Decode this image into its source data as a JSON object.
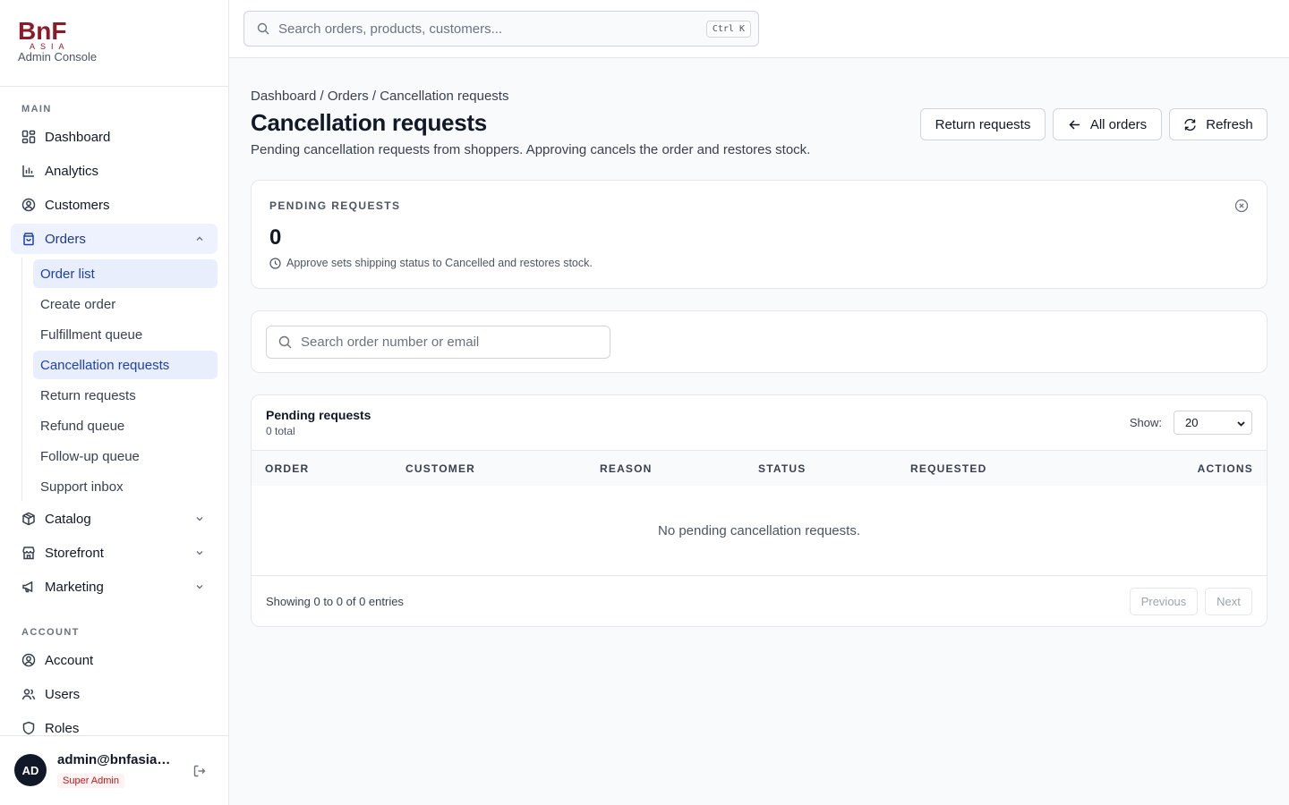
{
  "brand": {
    "logo_text": "BnF",
    "logo_subtext": "ASIA",
    "subtitle": "Admin Console",
    "logo_color": "#8b1a2b"
  },
  "sidebar": {
    "sections": {
      "main": "MAIN",
      "account": "ACCOUNT"
    },
    "items": {
      "dashboard": {
        "label": "Dashboard",
        "icon": "dashboard-grid-icon"
      },
      "analytics": {
        "label": "Analytics",
        "icon": "bar-chart-icon"
      },
      "customers": {
        "label": "Customers",
        "icon": "user-circle-icon"
      },
      "orders": {
        "label": "Orders",
        "icon": "shopping-bag-icon"
      },
      "catalog": {
        "label": "Catalog",
        "icon": "package-icon"
      },
      "storefront": {
        "label": "Storefront",
        "icon": "store-icon"
      },
      "marketing": {
        "label": "Marketing",
        "icon": "megaphone-icon"
      },
      "account": {
        "label": "Account",
        "icon": "user-circle-icon"
      },
      "users": {
        "label": "Users",
        "icon": "users-icon"
      },
      "roles": {
        "label": "Roles",
        "icon": "shield-icon"
      }
    },
    "orders_sub": {
      "order_list": "Order list",
      "create_order": "Create order",
      "fulfillment_queue": "Fulfillment queue",
      "cancellation_requests": "Cancellation requests",
      "return_requests": "Return requests",
      "refund_queue": "Refund queue",
      "followup_queue": "Follow-up queue",
      "support_inbox": "Support inbox"
    }
  },
  "user": {
    "initials": "AD",
    "email": "admin@bnfasia.com",
    "role": "Super Admin"
  },
  "topbar": {
    "search_placeholder": "Search orders, products, customers...",
    "shortcut": "Ctrl K"
  },
  "page": {
    "breadcrumb": "Dashboard / Orders / Cancellation requests",
    "title": "Cancellation requests",
    "description": "Pending cancellation requests from shoppers. Approving cancels the order and restores stock.",
    "buttons": {
      "return_requests": "Return requests",
      "all_orders": "All orders",
      "refresh": "Refresh"
    }
  },
  "stat": {
    "label": "PENDING REQUESTS",
    "value": "0",
    "note": "Approve sets shipping status to Cancelled and restores stock."
  },
  "filter": {
    "search_placeholder": "Search order number or email"
  },
  "table": {
    "title": "Pending requests",
    "subtitle": "0 total",
    "show_label": "Show:",
    "page_size": "20",
    "columns": {
      "order": "ORDER",
      "customer": "CUSTOMER",
      "reason": "REASON",
      "status": "STATUS",
      "requested": "REQUESTED",
      "actions": "ACTIONS"
    },
    "empty_message": "No pending cancellation requests.",
    "entries_text": "Showing 0 to 0 of 0 entries",
    "previous": "Previous",
    "next": "Next"
  },
  "colors": {
    "accent": "#1e40af",
    "active_bg": "#eef2ff",
    "role_badge": "#b91c1c"
  }
}
